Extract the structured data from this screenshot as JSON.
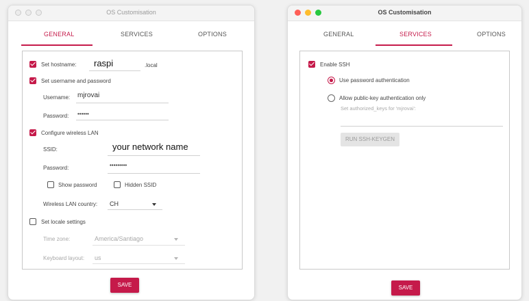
{
  "left_window": {
    "title": "OS Customisation",
    "tabs": [
      "GENERAL",
      "SERVICES",
      "OPTIONS"
    ],
    "active_tab": "GENERAL",
    "set_hostname": {
      "label": "Set hostname:",
      "checked": true,
      "value": "raspi",
      "suffix": ".local"
    },
    "set_user": {
      "label": "Set username and password",
      "checked": true,
      "username_label": "Username:",
      "username_value": "mjrovai",
      "password_label": "Password:",
      "password_value": "••••••"
    },
    "wireless": {
      "label": "Configure wireless LAN",
      "checked": true,
      "ssid_label": "SSID:",
      "ssid_value": "your network name",
      "password_label": "Password:",
      "password_value": "•••••••••",
      "show_password": "Show password",
      "hidden_ssid": "Hidden SSID",
      "country_label": "Wireless LAN country:",
      "country_value": "CH"
    },
    "locale": {
      "label": "Set locale settings",
      "checked": false,
      "timezone_label": "Time zone:",
      "timezone_value": "America/Santiago",
      "keyboard_label": "Keyboard layout:",
      "keyboard_value": "us"
    },
    "save_label": "SAVE"
  },
  "right_window": {
    "title": "OS Customisation",
    "tabs": [
      "GENERAL",
      "SERVICES",
      "OPTIONS"
    ],
    "active_tab": "SERVICES",
    "enable_ssh": {
      "label": "Enable SSH",
      "checked": true
    },
    "use_password": {
      "label": "Use password authentication",
      "selected": true
    },
    "public_key": {
      "label": "Allow public-key authentication only",
      "selected": false,
      "hint": "Set authorized_keys for 'mjrovai':"
    },
    "keygen_label": "RUN SSH-KEYGEN",
    "save_label": "SAVE"
  },
  "colors": {
    "accent": "#c51a4a",
    "window_bg": "#ffffff",
    "page_bg": "#f1f1f1"
  }
}
